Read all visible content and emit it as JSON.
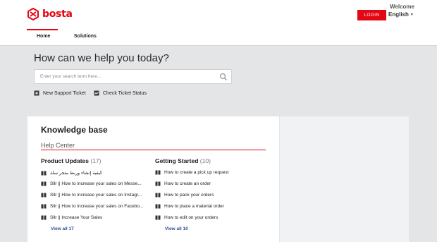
{
  "brand": {
    "name": "bosta",
    "color": "#e30613"
  },
  "header": {
    "welcome": "Welcome",
    "login": "LOGIN",
    "language": "English",
    "tabs": [
      {
        "label": "Home",
        "active": true
      },
      {
        "label": "Solutions",
        "active": false
      }
    ]
  },
  "hero": {
    "title": "How can we help you today?",
    "search_placeholder": "Enter your search term here...",
    "actions": [
      {
        "label": "New Support Ticket",
        "icon": "ticket-icon"
      },
      {
        "label": "Check Ticket Status",
        "icon": "status-icon"
      }
    ]
  },
  "kb": {
    "title": "Knowledge base",
    "section": "Help Center",
    "columns": [
      {
        "title": "Product Updates",
        "count": "(17)",
        "articles": [
          "كيفية إنشاء وربط متجر سلة",
          "Sllr || How to increase your sales on Messe...",
          "Sllr || How to increase your sales on Instagr...",
          "Sllr || How to increase your sales on Facebo...",
          "Sllr || Increase Your Sales"
        ],
        "view_all": "View all 17"
      },
      {
        "title": "Getting Started",
        "count": "(10)",
        "articles": [
          "How to create a pick up request",
          "How to create an order",
          "How to pack your orders",
          "How to place a material order",
          "How to edit on your orders"
        ],
        "view_all": "View all 10"
      }
    ]
  }
}
